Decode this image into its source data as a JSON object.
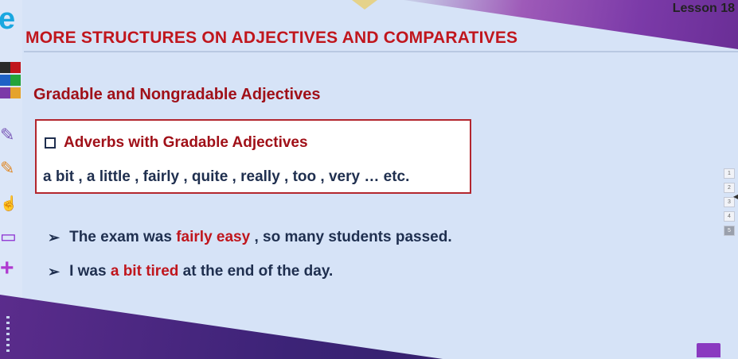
{
  "header": {
    "lesson": "Lesson 18",
    "title": "MORE STRUCTURES ON ADJECTIVES AND COMPARATIVES",
    "watermark": "my e com"
  },
  "section": {
    "subtitle": "Gradable and Nongradable Adjectives"
  },
  "box": {
    "heading": "Adverbs with Gradable Adjectives",
    "body": "a bit , a little , fairly , quite , really , too , very … etc."
  },
  "examples": [
    {
      "before": "The exam was",
      "highlight": "fairly easy",
      "after": ", so many students passed."
    },
    {
      "before": "I was",
      "highlight": "a bit tired",
      "after": "at the end of the day."
    }
  ],
  "toolbar": {
    "palette_colors": [
      "#2a2a2a",
      "#c0161d",
      "#1e62c6",
      "#23a33a",
      "#7b3aa8",
      "#e5a32c"
    ],
    "tools": [
      "pencil-icon",
      "pencil-icon",
      "select-hand-icon",
      "monitor-icon",
      "plus-icon"
    ]
  },
  "pagination": [
    "1",
    "2",
    "3",
    "4",
    "5"
  ],
  "colors": {
    "title_red": "#c0161d",
    "text_navy": "#1f2f4f",
    "background": "#d6e3f7"
  }
}
